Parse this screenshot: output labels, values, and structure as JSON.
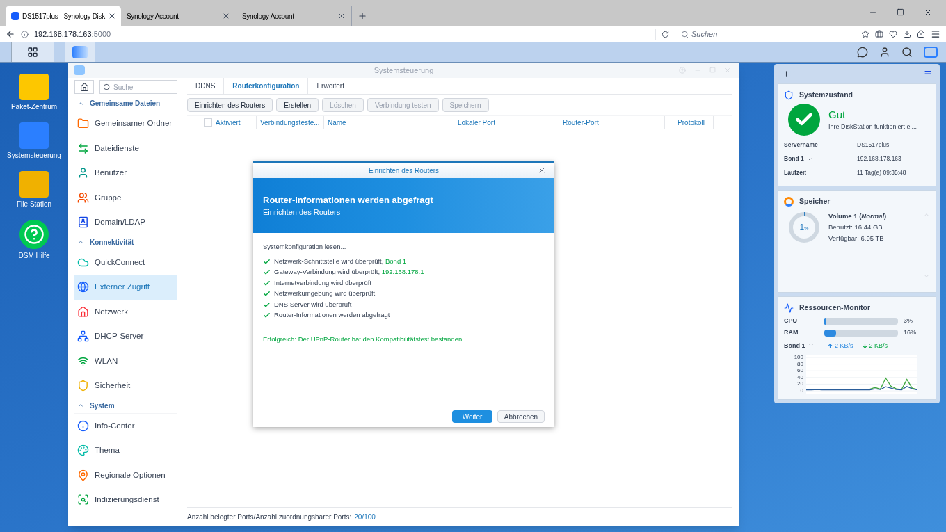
{
  "browser": {
    "tabs": [
      {
        "title": "DS1517plus - Synology Disk",
        "selected": true
      },
      {
        "title": "Synology Account",
        "selected": false
      },
      {
        "title": "Synology Account",
        "selected": false
      }
    ],
    "url_host": "192.168.178.163",
    "url_port": ":5000",
    "search_placeholder": "Suchen"
  },
  "desktop_icons": [
    {
      "label": "Paket-Zentrum"
    },
    {
      "label": "Systemsteuerung"
    },
    {
      "label": "File Station"
    },
    {
      "label": "DSM Hilfe"
    }
  ],
  "window": {
    "title": "Systemsteuerung",
    "sidebar": {
      "search_placeholder": "Suche",
      "sections": [
        {
          "title": "Gemeinsame Dateien",
          "expanded": true,
          "items": [
            {
              "label": "Gemeinsamer Ordner",
              "selected": false
            },
            {
              "label": "Dateidienste",
              "selected": false
            },
            {
              "label": "Benutzer",
              "selected": false
            },
            {
              "label": "Gruppe",
              "selected": false
            },
            {
              "label": "Domain/LDAP",
              "selected": false
            }
          ]
        },
        {
          "title": "Konnektivität",
          "expanded": true,
          "items": [
            {
              "label": "QuickConnect",
              "selected": false
            },
            {
              "label": "Externer Zugriff",
              "selected": true
            },
            {
              "label": "Netzwerk",
              "selected": false
            },
            {
              "label": "DHCP-Server",
              "selected": false
            },
            {
              "label": "WLAN",
              "selected": false
            },
            {
              "label": "Sicherheit",
              "selected": false
            }
          ]
        },
        {
          "title": "System",
          "expanded": true,
          "items": [
            {
              "label": "Info-Center",
              "selected": false
            },
            {
              "label": "Thema",
              "selected": false
            },
            {
              "label": "Regionale Optionen",
              "selected": false
            },
            {
              "label": "Indizierungsdienst",
              "selected": false
            }
          ]
        }
      ]
    },
    "tabs": [
      {
        "label": "DDNS",
        "selected": false
      },
      {
        "label": "Routerkonfiguration",
        "selected": true
      },
      {
        "label": "Erweitert",
        "selected": false
      }
    ],
    "toolbar": [
      {
        "label": "Einrichten des Routers",
        "disabled": false
      },
      {
        "label": "Erstellen",
        "disabled": false
      },
      {
        "label": "Löschen",
        "disabled": true
      },
      {
        "label": "Verbindung testen",
        "disabled": true
      },
      {
        "label": "Speichern",
        "disabled": true
      }
    ],
    "table": {
      "select_all_checked": false,
      "columns": [
        "Aktiviert",
        "Verbindungsteste...",
        "Name",
        "Lokaler Port",
        "Router-Port",
        "Protokoll"
      ]
    },
    "footer": {
      "label": "Anzahl belegter Ports/Anzahl zuordnungsbarer Ports:",
      "value": "20/100"
    }
  },
  "dialog": {
    "title": "Einrichten des Routers",
    "banner_title": "Router-Informationen werden abgefragt",
    "banner_subtitle": "Einrichten des Routers",
    "intro": "Systemkonfiguration lesen...",
    "checks": [
      {
        "text": "Netzwerk-Schnittstelle wird überprüft, ",
        "detail": "Bond 1",
        "done": true
      },
      {
        "text": "Gateway-Verbindung wird überprüft, ",
        "detail": "192.168.178.1",
        "done": true
      },
      {
        "text": "Internetverbindung wird überprüft",
        "done": true
      },
      {
        "text": "Netzwerkumgebung wird überprüft",
        "done": true
      },
      {
        "text": "DNS Server wird überprüft",
        "done": true
      },
      {
        "text": "Router-Informationen werden abgefragt",
        "done": true
      }
    ],
    "result": "Erfolgreich: Der UPnP-Router hat den Kompatibilitätstest bestanden.",
    "buttons": [
      {
        "label": "Weiter",
        "kind": "primary"
      },
      {
        "label": "Abbrechen",
        "kind": "secondary"
      }
    ]
  },
  "widgets": {
    "system": {
      "title": "Systemzustand",
      "status": "Gut",
      "message": "Ihre DiskStation funktioniert ei...",
      "rows": [
        {
          "label": "Servername",
          "value": "DS1517plus",
          "dropdown": false
        },
        {
          "label": "Bond 1",
          "value": "192.168.178.163",
          "dropdown": true
        },
        {
          "label": "Laufzeit",
          "value": "11 Tag(e) 09:35:48",
          "dropdown": false
        }
      ]
    },
    "storage": {
      "title": "Speicher",
      "volume": "Volume 1 (*Normal*)",
      "used": "Benutzt: 16.44 GB",
      "free": "Verfügbar: 6.95 TB",
      "percent": "1",
      "unit": "%",
      "level": 0.01
    },
    "monitor": {
      "title": "Ressourcen-Monitor",
      "meters": [
        {
          "label": "CPU",
          "level": 0.03,
          "reading": "3%"
        },
        {
          "label": "RAM",
          "level": 0.16,
          "reading": "16%"
        }
      ],
      "interface": "Bond 1",
      "upload": "2 KB/s",
      "download": "2 KB/s",
      "chart_data": {
        "type": "line",
        "grid": true,
        "ylim": [
          0,
          100
        ],
        "yticks": [
          0,
          20,
          40,
          60,
          80,
          100
        ],
        "series": [
          {
            "color": "#3aa53a",
            "values": [
              4,
              4,
              5,
              4,
              4,
              4,
              4,
              4,
              4,
              4,
              4,
              4,
              5,
              10,
              5,
              38,
              14,
              6,
              4,
              34,
              8,
              4
            ]
          },
          {
            "color": "#2a5d9a",
            "values": [
              3,
              3,
              4,
              3,
              3,
              3,
              3,
              3,
              3,
              3,
              3,
              3,
              3,
              6,
              4,
              12,
              8,
              4,
              3,
              13,
              6,
              3
            ]
          }
        ]
      }
    }
  }
}
